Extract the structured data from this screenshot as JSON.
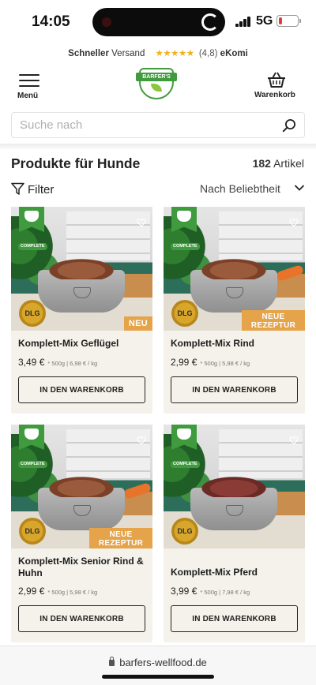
{
  "status_bar": {
    "time": "14:05",
    "network": "5G",
    "battery_level": 0.1
  },
  "shipping_bar": {
    "bold_text": "Schneller",
    "text": "Versand",
    "stars": "★★★★★",
    "rating": "(4,8)",
    "provider": "eKomi"
  },
  "header": {
    "menu_label": "Menü",
    "logo_text": "BARFER'S",
    "cart_label": "Warenkorb"
  },
  "search": {
    "placeholder": "Suche nach",
    "value": ""
  },
  "listing": {
    "title": "Produkte für Hunde",
    "count": "182",
    "count_label": "Artikel",
    "filter_label": "Filter",
    "sort_label": "Nach Beliebtheit"
  },
  "products": [
    {
      "name": "Komplett-Mix Geflügel",
      "price": "3,49 €",
      "base_price": "* 500g | 6,98 € / kg",
      "tag": "NEU",
      "button": "IN DEN WARENKORB",
      "badge_logo": "BARFER'S",
      "complete": "COMPLETE",
      "seal": "DLG"
    },
    {
      "name": "Komplett-Mix Rind",
      "price": "2,99 €",
      "base_price": "* 500g | 5,98 € / kg",
      "tag": "NEUE REZEPTUR",
      "button": "IN DEN WARENKORB",
      "badge_logo": "BARFER'S",
      "complete": "COMPLETE",
      "seal": "DLG"
    },
    {
      "name": "Komplett-Mix Senior Rind & Huhn",
      "price": "2,99 €",
      "base_price": "* 500g | 5,98 € / kg",
      "tag": "NEUE REZEPTUR",
      "button": "IN DEN WARENKORB",
      "badge_logo": "BARFER'S",
      "complete": "COMPLETE",
      "seal": "DLG"
    },
    {
      "name": "Komplett-Mix Pferd",
      "price": "3,99 €",
      "base_price": "* 500g | 7,98 € / kg",
      "tag": "",
      "button": "IN DEN WARENKORB",
      "badge_logo": "BARFER'S",
      "complete": "COMPLETE",
      "seal": "DLG"
    }
  ],
  "browser": {
    "url": "barfers-wellfood.de"
  },
  "colors": {
    "brand_green": "#3f9b3d",
    "tag_orange": "#e5a34a",
    "star_yellow": "#f2b21b",
    "card_bg": "#f4f2ea"
  }
}
